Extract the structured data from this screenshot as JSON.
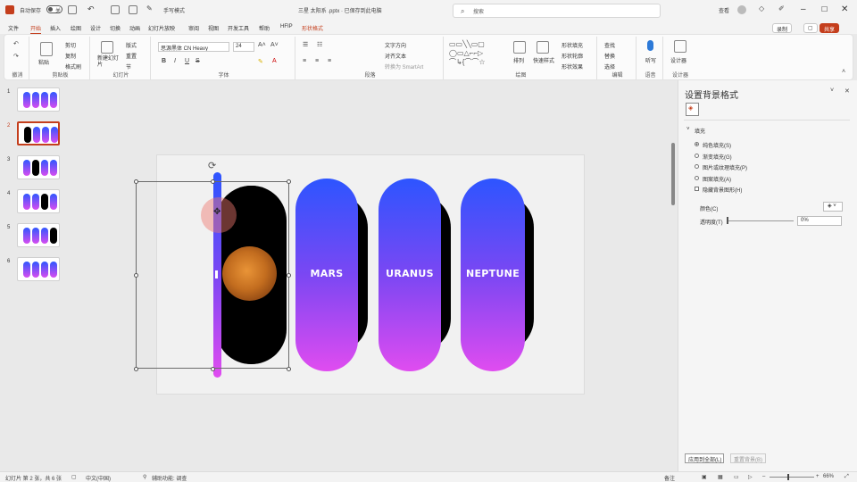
{
  "titlebar": {
    "autosave_label": "自动保存",
    "autosave_state": "关",
    "hand_draw": "手写模式",
    "doc_title": "三星 太阳系 .pptx · 已保存到此电脑",
    "search_placeholder": "搜索",
    "user": "查看",
    "rec_badge": "录制",
    "share_badge": "共享"
  },
  "menu": [
    "文件",
    "开始",
    "插入",
    "绘图",
    "设计",
    "切换",
    "动画",
    "幻灯片放映",
    "审阅",
    "视图",
    "开发工具",
    "帮助",
    "HFIP",
    "形状格式"
  ],
  "active_menu": "开始",
  "ribbon": {
    "clipboard": {
      "paste": "粘贴",
      "cut": "剪切",
      "copy": "复制",
      "format_painter": "格式刷",
      "label": "剪贴板"
    },
    "undo_label": "撤消",
    "slides": {
      "new_slide": "新建幻灯片",
      "layout": "版式",
      "reset": "重置",
      "section": "节",
      "label": "幻灯片"
    },
    "font": {
      "name": "思源黑体 CN Heavy",
      "size": "24",
      "bold": "B",
      "italic": "I",
      "underline": "U",
      "strike": "S",
      "label": "字体"
    },
    "paragraph": {
      "text_dir": "文字方向",
      "align_text": "对齐文本",
      "smartart": "转换为 SmartArt",
      "label": "段落"
    },
    "drawing": {
      "arrange": "排列",
      "quick_styles": "快速样式",
      "fill": "形状填充",
      "outline": "形状轮廓",
      "effects": "形状效果",
      "label": "绘图"
    },
    "editing": {
      "find": "查找",
      "replace": "替换",
      "select": "选择",
      "label": "编辑"
    },
    "voice": {
      "dictate": "听写",
      "label": "语音"
    },
    "designer": {
      "btn": "设计器",
      "label": "设计器"
    }
  },
  "thumbnails": [
    {
      "num": "1",
      "pills": [
        "grad",
        "grad",
        "grad",
        "grad"
      ]
    },
    {
      "num": "2",
      "pills": [
        "black",
        "grad",
        "grad",
        "grad"
      ],
      "active": true
    },
    {
      "num": "3",
      "pills": [
        "grad",
        "black",
        "grad",
        "grad"
      ]
    },
    {
      "num": "4",
      "pills": [
        "grad",
        "grad",
        "black",
        "grad"
      ]
    },
    {
      "num": "5",
      "pills": [
        "grad",
        "grad",
        "grad",
        "black"
      ]
    },
    {
      "num": "6",
      "pills": [
        "grad",
        "grad",
        "grad",
        "grad"
      ]
    }
  ],
  "slide": {
    "cards": [
      {
        "label": "",
        "style": "black"
      },
      {
        "label": "MARS",
        "style": "grad"
      },
      {
        "label": "URANUS",
        "style": "grad"
      },
      {
        "label": "NEPTUNE",
        "style": "grad"
      }
    ]
  },
  "pane": {
    "title": "设置背景格式",
    "section_fill": "填充",
    "options": [
      "纯色填充(S)",
      "渐变填充(G)",
      "图片或纹理填充(P)",
      "图案填充(A)"
    ],
    "selected_option": 0,
    "hide_bg": "隐藏背景图形(H)",
    "color_label": "颜色(C)",
    "transparency_label": "透明度(T)",
    "transparency_value": "0%",
    "apply_all": "应用到全部(L)",
    "reset_bg": "重置背景(B)"
  },
  "status": {
    "slide_info": "幻灯片 第 2 张，共 6 张",
    "language": "中文(中国)",
    "accessibility": "辅助功能: 调查",
    "notes": "备注",
    "zoom": "66%"
  },
  "colors": {
    "accent": "#c43e1c",
    "grad_top": "#2d55ff",
    "grad_bottom": "#e04cf0"
  }
}
